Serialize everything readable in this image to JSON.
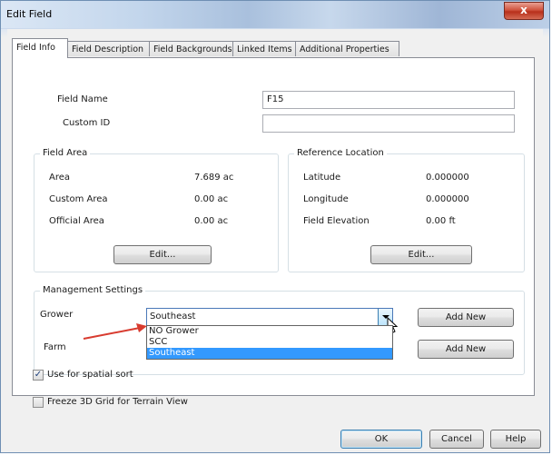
{
  "window": {
    "title": "Edit Field",
    "close_label": "x"
  },
  "tabs": [
    {
      "label": "Field Info",
      "active": true
    },
    {
      "label": "Field Description"
    },
    {
      "label": "Field Backgrounds"
    },
    {
      "label": "Linked Items"
    },
    {
      "label": "Additional Properties"
    }
  ],
  "field_info": {
    "name_label": "Field Name",
    "name_value": "F15",
    "custom_id_label": "Custom ID",
    "custom_id_value": ""
  },
  "field_area": {
    "title": "Field Area",
    "rows": [
      {
        "label": "Area",
        "value": "7.689 ac"
      },
      {
        "label": "Custom Area",
        "value": "0.00 ac"
      },
      {
        "label": "Official Area",
        "value": "0.00 ac"
      }
    ],
    "edit_label": "Edit..."
  },
  "reference_location": {
    "title": "Reference Location",
    "rows": [
      {
        "label": "Latitude",
        "value": "0.000000"
      },
      {
        "label": "Longitude",
        "value": "0.000000"
      },
      {
        "label": "Field Elevation",
        "value": "0.00 ft"
      }
    ],
    "edit_label": "Edit..."
  },
  "management": {
    "title": "Management Settings",
    "grower_label": "Grower",
    "grower_value": "Southeast",
    "grower_options": [
      "NO Grower",
      "SCC",
      "Southeast"
    ],
    "farm_label": "Farm",
    "add_new_label": "Add New"
  },
  "checkboxes": {
    "spatial_sort_label": "Use for spatial sort",
    "spatial_sort_checked": true,
    "freeze_label": "Freeze 3D Grid for Terrain View",
    "freeze_checked": false
  },
  "footer": {
    "ok_label": "OK",
    "cancel_label": "Cancel",
    "help_label": "Help"
  },
  "colors": {
    "selection": "#3399ff",
    "arrow": "#d83b2f"
  }
}
